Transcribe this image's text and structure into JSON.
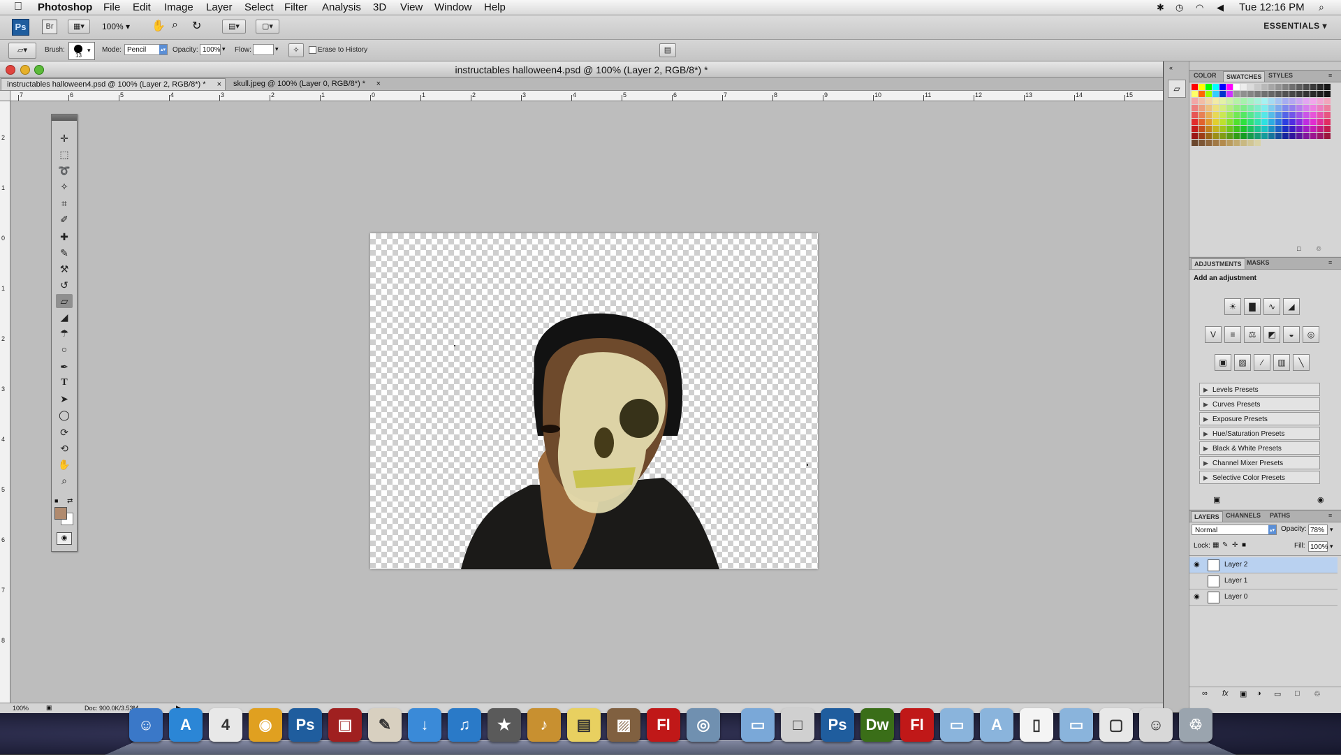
{
  "menubar": {
    "app_name": "Photoshop",
    "menus": [
      "File",
      "Edit",
      "Image",
      "Layer",
      "Select",
      "Filter",
      "Analysis",
      "3D",
      "View",
      "Window",
      "Help"
    ],
    "clock": "Tue 12:16 PM"
  },
  "appbar": {
    "ps_badge": "Ps",
    "br_badge": "Br",
    "zoom": "100%",
    "workspace": "ESSENTIALS ▾"
  },
  "options": {
    "brush_label": "Brush:",
    "brush_size": "13",
    "mode_label": "Mode:",
    "mode_value": "Pencil",
    "opacity_label": "Opacity:",
    "opacity_value": "100%",
    "flow_label": "Flow:",
    "flow_value": "",
    "erase_history": "Erase to History"
  },
  "document": {
    "window_title": "instructables halloween4.psd @ 100% (Layer 2, RGB/8*) *",
    "tabs": [
      {
        "label": "instructables halloween4.psd @ 100% (Layer 2, RGB/8*) *",
        "close": "×"
      },
      {
        "label": "skull.jpeg @ 100% (Layer 0, RGB/8*) *",
        "close": "×"
      }
    ],
    "ruler_top": [
      "7",
      "6",
      "5",
      "4",
      "3",
      "2",
      "1",
      "0",
      "1",
      "2",
      "3",
      "4",
      "5",
      "6",
      "7",
      "8",
      "9",
      "10",
      "11",
      "12",
      "13",
      "14",
      "15"
    ],
    "ruler_left": [
      "2",
      "1",
      "0",
      "1",
      "2",
      "3",
      "4",
      "5",
      "6",
      "7",
      "8"
    ],
    "status_zoom": "100%",
    "status_doc": "Doc: 900.0K/3.53M"
  },
  "panels": {
    "swatch_tabs": [
      "COLOR",
      "SWATCHES",
      "STYLES"
    ],
    "adjust_tabs": [
      "ADJUSTMENTS",
      "MASKS"
    ],
    "adjust_heading": "Add an adjustment",
    "presets": [
      "Levels Presets",
      "Curves Presets",
      "Exposure Presets",
      "Hue/Saturation Presets",
      "Black & White Presets",
      "Channel Mixer Presets",
      "Selective Color Presets"
    ],
    "layer_tabs": [
      "LAYERS",
      "CHANNELS",
      "PATHS"
    ],
    "blend_mode": "Normal",
    "opacity_label": "Opacity:",
    "opacity_value": "78%",
    "lock_label": "Lock:",
    "fill_label": "Fill:",
    "fill_value": "100%",
    "layers": [
      {
        "name": "Layer 2",
        "visible": true,
        "selected": true
      },
      {
        "name": "Layer 1",
        "visible": false,
        "selected": false
      },
      {
        "name": "Layer 0",
        "visible": true,
        "selected": false
      }
    ]
  },
  "colors": {
    "foreground": "#b08a6e",
    "background": "#ffffff",
    "selection": "#b9d1f0"
  },
  "dock": {
    "items": [
      {
        "name": "finder-icon",
        "glyph": "☺",
        "color": "#3a78c8"
      },
      {
        "name": "app-store-icon",
        "glyph": "A",
        "color": "#2b86d6"
      },
      {
        "name": "calendar-icon",
        "glyph": "4",
        "color": "#e8e8e8"
      },
      {
        "name": "chrome-icon",
        "glyph": "◉",
        "color": "#e0a020"
      },
      {
        "name": "photoshop-icon",
        "glyph": "Ps",
        "color": "#1f5d9e"
      },
      {
        "name": "photo-booth-icon",
        "glyph": "▣",
        "color": "#a02020"
      },
      {
        "name": "textedit-icon",
        "glyph": "✎",
        "color": "#d8d0c0"
      },
      {
        "name": "downloads-icon",
        "glyph": "↓",
        "color": "#3a8ad8"
      },
      {
        "name": "itunes-icon",
        "glyph": "♫",
        "color": "#2a7ac8"
      },
      {
        "name": "imovie-icon",
        "glyph": "★",
        "color": "#5a5a5a"
      },
      {
        "name": "garageband-icon",
        "glyph": "♪",
        "color": "#c89030"
      },
      {
        "name": "stickies-icon",
        "glyph": "▤",
        "color": "#e8d060"
      },
      {
        "name": "iphoto-icon",
        "glyph": "▨",
        "color": "#806040"
      },
      {
        "name": "flash-icon",
        "glyph": "Fl",
        "color": "#c01818"
      },
      {
        "name": "preview-icon",
        "glyph": "◎",
        "color": "#7090b0"
      },
      {
        "name": "folder-icon",
        "glyph": "▭",
        "color": "#7aa8d8"
      },
      {
        "name": "disk-icon",
        "glyph": "□",
        "color": "#d0d0d0"
      },
      {
        "name": "photoshop-doc-icon",
        "glyph": "Ps",
        "color": "#1f5d9e"
      },
      {
        "name": "dreamweaver-icon",
        "glyph": "Dw",
        "color": "#3a6e18"
      },
      {
        "name": "flash-doc-icon",
        "glyph": "Fl",
        "color": "#c01818"
      },
      {
        "name": "documents-folder-icon",
        "glyph": "▭",
        "color": "#8ab4dc"
      },
      {
        "name": "applications-folder-icon",
        "glyph": "A",
        "color": "#8ab4dc"
      },
      {
        "name": "file-icon",
        "glyph": "▯",
        "color": "#f4f4f4"
      },
      {
        "name": "windows-folder-icon",
        "glyph": "▭",
        "color": "#8ab4dc"
      },
      {
        "name": "screenshot-icon",
        "glyph": "▢",
        "color": "#e8e8e8"
      },
      {
        "name": "contact-icon",
        "glyph": "☺",
        "color": "#d8d8d8"
      },
      {
        "name": "trash-icon",
        "glyph": "♲",
        "color": "#9aa4ae"
      }
    ]
  }
}
